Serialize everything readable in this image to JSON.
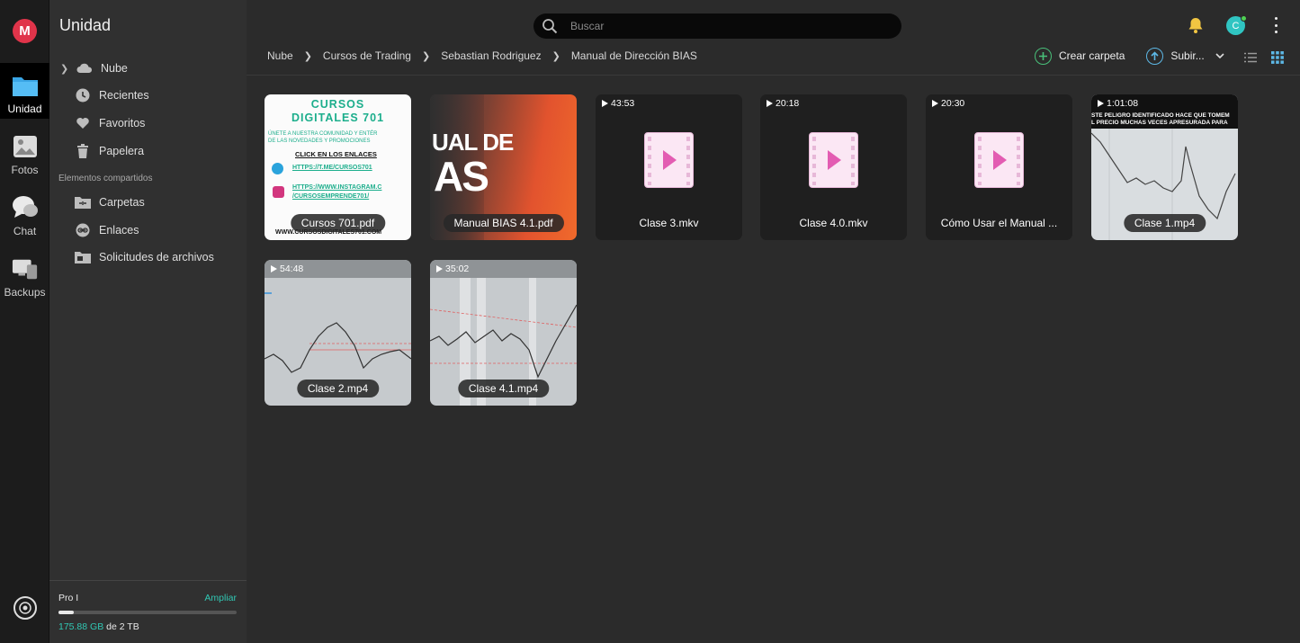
{
  "rail": {
    "logo_letter": "M",
    "items": [
      {
        "label": "Unidad",
        "icon": "folder-icon"
      },
      {
        "label": "Fotos",
        "icon": "image-icon"
      },
      {
        "label": "Chat",
        "icon": "chat-icon"
      },
      {
        "label": "Backups",
        "icon": "backups-icon"
      }
    ]
  },
  "sidebar": {
    "title": "Unidad",
    "items": [
      {
        "label": "Nube",
        "icon": "cloud-icon"
      },
      {
        "label": "Recientes",
        "icon": "clock-icon"
      },
      {
        "label": "Favoritos",
        "icon": "heart-icon"
      },
      {
        "label": "Papelera",
        "icon": "trash-icon"
      }
    ],
    "shared_section_label": "Elementos compartidos",
    "shared_items": [
      {
        "label": "Carpetas",
        "icon": "shared-folder-icon"
      },
      {
        "label": "Enlaces",
        "icon": "link-icon"
      },
      {
        "label": "Solicitudes de archivos",
        "icon": "file-request-icon"
      }
    ],
    "storage": {
      "plan": "Pro I",
      "upgrade_label": "Ampliar",
      "used": "175.88 GB",
      "total": "de 2 TB",
      "fraction_used": 0.086
    }
  },
  "search": {
    "placeholder": "Buscar"
  },
  "avatar": {
    "letter": "C",
    "color": "#30c5c2"
  },
  "breadcrumb": [
    "Nube",
    "Cursos de Trading",
    "Sebastian Rodriguez",
    "Manual de Dirección BIAS"
  ],
  "actions": {
    "create_folder": "Crear carpeta",
    "upload": "Subir..."
  },
  "files": [
    {
      "name": "Cursos 701.pdf",
      "kind": "pdf-promo",
      "duration": ""
    },
    {
      "name": "Manual BIAS 4.1.pdf",
      "kind": "pdf-cover",
      "duration": ""
    },
    {
      "name": "Clase 3.mkv",
      "kind": "video-placeholder",
      "duration": "43:53"
    },
    {
      "name": "Clase 4.0.mkv",
      "kind": "video-placeholder",
      "duration": "20:18"
    },
    {
      "name": "Cómo Usar el Manual ...",
      "kind": "video-placeholder",
      "duration": "20:30"
    },
    {
      "name": "Clase 1.mp4",
      "kind": "video-chart-dark",
      "duration": "1:01:08"
    },
    {
      "name": "Clase 2.mp4",
      "kind": "video-chart",
      "duration": "54:48"
    },
    {
      "name": "Clase 4.1.mp4",
      "kind": "video-chart2",
      "duration": "35:02"
    }
  ],
  "thumb_text": {
    "promo_title_1": "CURSOS",
    "promo_title_2": "DIGITALES 701",
    "promo_line_1": "ÚNETE A NUESTRA COMUNIDAD Y ENTÉR",
    "promo_line_2": "DE LAS NOVEDADES Y PROMOCIONES",
    "promo_click": "CLICK EN LOS ENLACES",
    "promo_link_1": "HTTPS://T.ME/CURSOS701",
    "promo_link_2a": "HTTPS://WWW.INSTAGRAM.C",
    "promo_link_2b": "/CURSOSEMPRENDE701/",
    "promo_footer": "WWW.CURSOSDIGITALES701.COM",
    "cover_line_1": "UAL DE",
    "cover_line_2": "AS",
    "chart_caption_1": "STE PELIGRO IDENTIFICADO HACE QUE TOMEM",
    "chart_caption_2": "L PRECIO MUCHAS VECES APRESURADA PARA"
  }
}
